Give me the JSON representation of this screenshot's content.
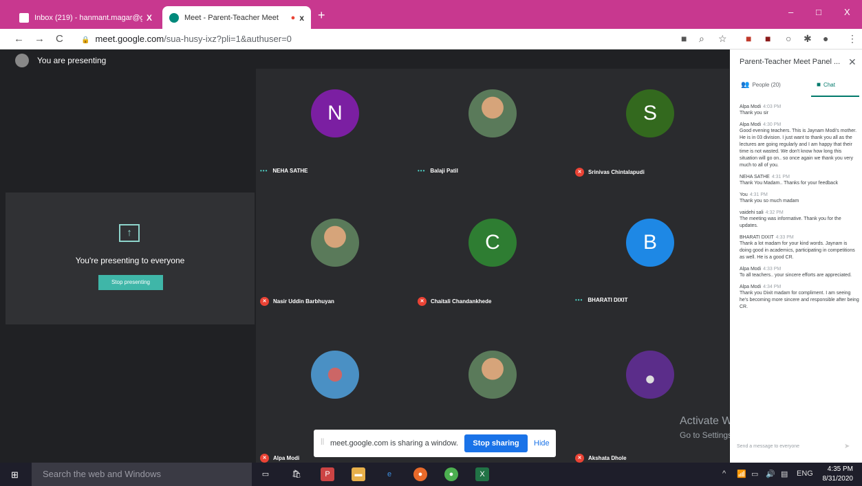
{
  "browser": {
    "tabs": [
      {
        "title": "Inbox (219) - hanmant.magar@g",
        "close": "X",
        "active": false
      },
      {
        "title": "Meet - Parent-Teacher Meet",
        "close": "x",
        "active": true
      }
    ],
    "new_tab": "+",
    "window_controls": {
      "minimize": "–",
      "maximize": "□",
      "close": "X"
    },
    "nav": {
      "back": "←",
      "forward": "→",
      "reload": "C"
    },
    "url": {
      "host": "meet.google.com",
      "path": "/sua-husy-ixz?pli=1&authuser=0"
    }
  },
  "meet": {
    "presenting_label": "You are presenting",
    "present_card": {
      "icon": "↑",
      "message": "You're presenting to everyone",
      "stop_button": "Stop presenting"
    },
    "participants": [
      {
        "name": "NEHA SATHE",
        "initial": "N",
        "color": "#7b1fa2",
        "status": "speaking"
      },
      {
        "name": "Balaji Patil",
        "initial": "",
        "color": "",
        "status": "speaking"
      },
      {
        "name": "Srinivas Chintalapudi",
        "initial": "S",
        "color": "#33691e",
        "status": "muted"
      },
      {
        "name": "Nasir Uddin Barbhuyan",
        "initial": "",
        "color": "",
        "status": "muted"
      },
      {
        "name": "Chaitali Chandankhede",
        "initial": "C",
        "color": "#2e7d32",
        "status": "muted"
      },
      {
        "name": "BHARATI DIXIT",
        "initial": "B",
        "color": "#1e88e5",
        "status": "speaking"
      },
      {
        "name": "Alpa Modi",
        "initial": "",
        "color": "",
        "status": "muted"
      },
      {
        "name": "",
        "initial": "",
        "color": "",
        "status": ""
      },
      {
        "name": "Akshata Dhole",
        "initial": "",
        "color": "",
        "status": "muted"
      }
    ],
    "sharing_bar": {
      "grip": "||",
      "message": "meet.google.com is sharing a window.",
      "stop_button": "Stop sharing",
      "hide_button": "Hide"
    },
    "watermark": {
      "title": "Activate Windows",
      "subtitle": "Go to Settings to activate Windows."
    }
  },
  "panel": {
    "title": "Parent-Teacher Meet Panel ...",
    "close": "✕",
    "tabs": {
      "people": "People (20)",
      "chat": "Chat"
    },
    "messages": [
      {
        "sender": "Alpa Modi",
        "time": "4:03 PM",
        "text": "Thank you sir"
      },
      {
        "sender": "Alpa Modi",
        "time": "4:30 PM",
        "text": "Good evening teachers. This is Jaynam Modi's mother. He is in 03 division. I just want to thank you all as the lectures are going regularly and I am happy that their time is not wasted. We don't know how long this situation will go on.. so once again we thank you very much to all of you."
      },
      {
        "sender": "NEHA SATHE",
        "time": "4:31 PM",
        "text": "Thank You Madam.. Thanks for your feedback"
      },
      {
        "sender": "You",
        "time": "4:31 PM",
        "text": "Thank you so much madam"
      },
      {
        "sender": "vaidehi sali",
        "time": "4:32 PM",
        "text": "The meeting was informative. Thank you for the updates."
      },
      {
        "sender": "BHARATI DIXIT",
        "time": "4:33 PM",
        "text": "Thank a lot madam for your kind words. Jaynam is doing good in academics, participating in competitions as well. He is a good CR."
      },
      {
        "sender": "Alpa Modi",
        "time": "4:33 PM",
        "text": "To all teachers.. your sincere efforts are appreciated."
      },
      {
        "sender": "Alpa Modi",
        "time": "4:34 PM",
        "text": "Thank you Dixit madam for compliment. I am seeing he's becoming more sincere and responsible after being CR."
      }
    ],
    "input_placeholder": "Send a message to everyone"
  },
  "taskbar": {
    "search_placeholder": "Search the web and Windows",
    "language": "ENG",
    "time": "4:35 PM",
    "date": "8/31/2020"
  }
}
